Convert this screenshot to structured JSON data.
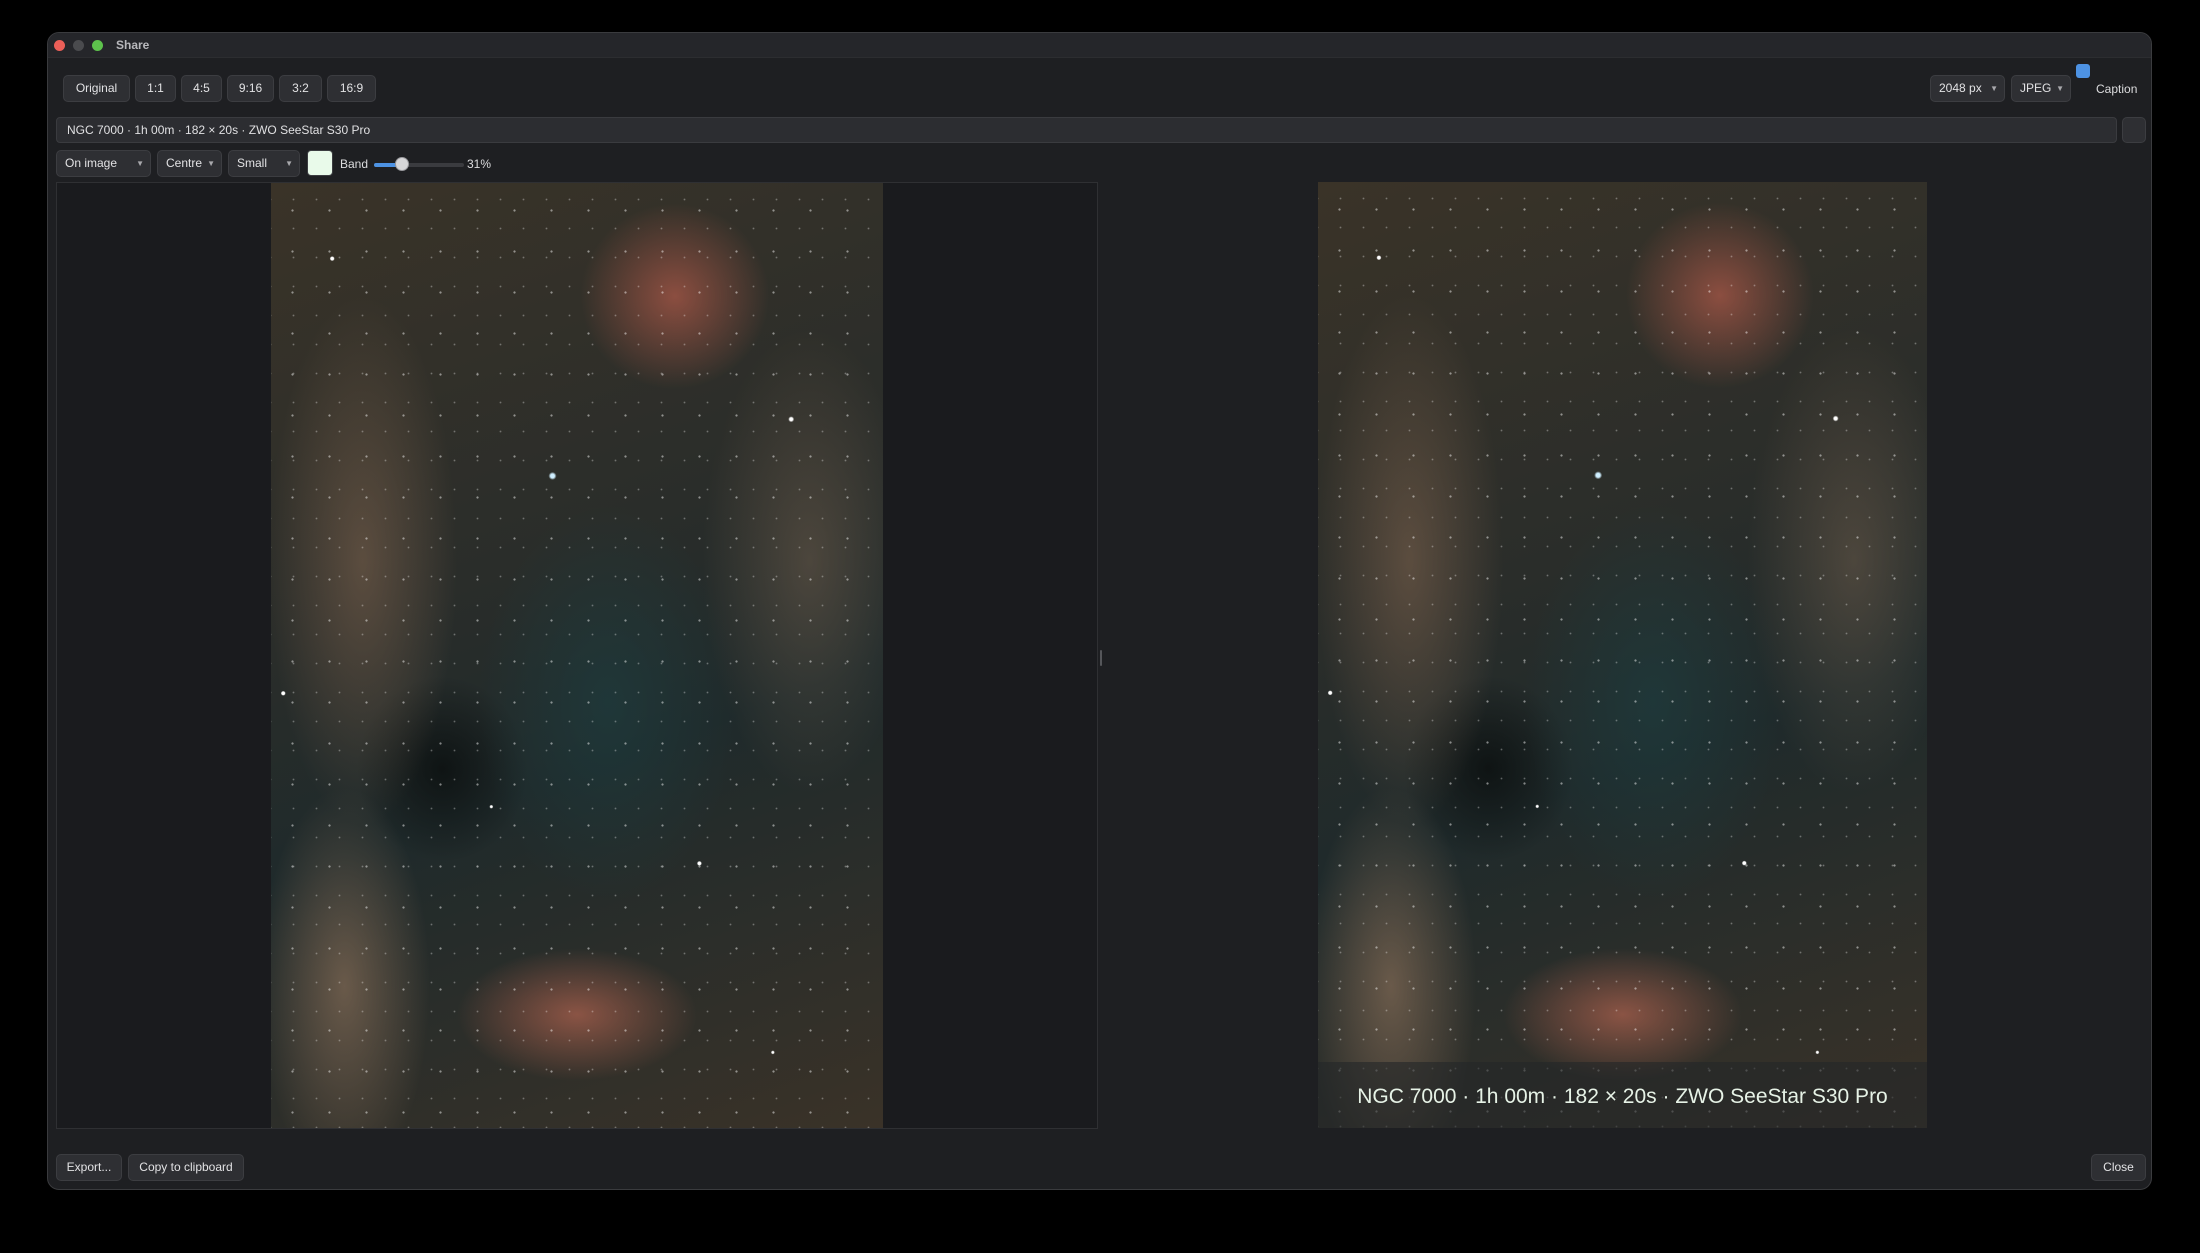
{
  "window": {
    "title": "Share"
  },
  "aspect_buttons": [
    "Original",
    "1:1",
    "4:5",
    "9:16",
    "3:2",
    "16:9"
  ],
  "size_select": {
    "value": "2048 px"
  },
  "format_select": {
    "value": "JPEG"
  },
  "caption_toggle": {
    "label": "Caption",
    "checked": true
  },
  "caption_text": "NGC 7000 · 1h 00m · 182 × 20s · ZWO SeeStar S30 Pro",
  "caption_controls": {
    "placement": "On image",
    "alignment": "Centre",
    "size": "Small",
    "band_label": "Band",
    "band_value": "31%",
    "band_fraction": 0.31,
    "swatch_color": "#e9faea"
  },
  "preview": {
    "caption": "NGC 7000 · 1h 00m · 182 × 20s · ZWO SeeStar S30 Pro"
  },
  "footer": {
    "export_label": "Export...",
    "copy_label": "Copy to clipboard",
    "close_label": "Close"
  }
}
